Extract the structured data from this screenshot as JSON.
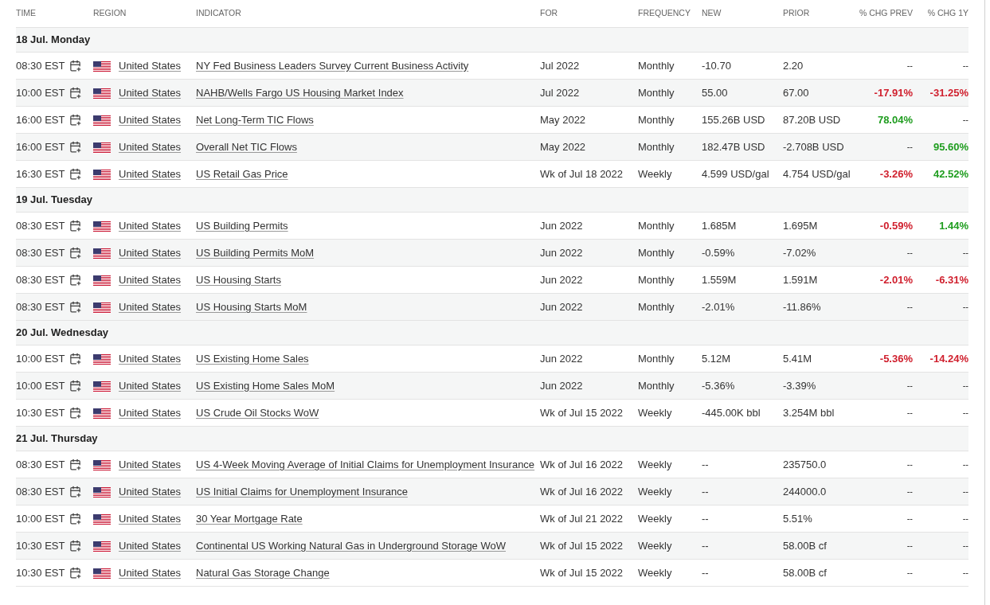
{
  "columns": [
    "TIME",
    "REGION",
    "INDICATOR",
    "FOR",
    "FREQUENCY",
    "NEW",
    "PRIOR",
    "% CHG PREV",
    "% CHG 1Y"
  ],
  "groups": [
    {
      "date": "18 Jul. Monday",
      "rows": [
        {
          "time": "08:30 EST",
          "region": "United States",
          "indicator": "NY Fed Business Leaders Survey Current Business Activity",
          "for": "Jul 2022",
          "frequency": "Monthly",
          "new": "-10.70",
          "prior": "2.20",
          "chg_prev": {
            "text": "--",
            "kind": "none"
          },
          "chg_1y": {
            "text": "--",
            "kind": "none"
          }
        },
        {
          "time": "10:00 EST",
          "region": "United States",
          "indicator": "NAHB/Wells Fargo US Housing Market Index",
          "for": "Jul 2022",
          "frequency": "Monthly",
          "new": "55.00",
          "prior": "67.00",
          "chg_prev": {
            "text": "-17.91%",
            "kind": "down"
          },
          "chg_1y": {
            "text": "-31.25%",
            "kind": "down"
          }
        },
        {
          "time": "16:00 EST",
          "region": "United States",
          "indicator": "Net Long-Term TIC Flows",
          "for": "May 2022",
          "frequency": "Monthly",
          "new": "155.26B USD",
          "prior": "87.20B USD",
          "chg_prev": {
            "text": "78.04%",
            "kind": "up"
          },
          "chg_1y": {
            "text": "--",
            "kind": "none"
          }
        },
        {
          "time": "16:00 EST",
          "region": "United States",
          "indicator": "Overall Net TIC Flows",
          "for": "May 2022",
          "frequency": "Monthly",
          "new": "182.47B USD",
          "prior": "-2.708B USD",
          "chg_prev": {
            "text": "--",
            "kind": "none"
          },
          "chg_1y": {
            "text": "95.60%",
            "kind": "up"
          }
        },
        {
          "time": "16:30 EST",
          "region": "United States",
          "indicator": "US Retail Gas Price",
          "for": "Wk of Jul 18 2022",
          "frequency": "Weekly",
          "new": "4.599 USD/gal",
          "prior": "4.754 USD/gal",
          "chg_prev": {
            "text": "-3.26%",
            "kind": "down"
          },
          "chg_1y": {
            "text": "42.52%",
            "kind": "up"
          }
        }
      ]
    },
    {
      "date": "19 Jul. Tuesday",
      "rows": [
        {
          "time": "08:30 EST",
          "region": "United States",
          "indicator": "US Building Permits",
          "for": "Jun 2022",
          "frequency": "Monthly",
          "new": "1.685M",
          "prior": "1.695M",
          "chg_prev": {
            "text": "-0.59%",
            "kind": "down"
          },
          "chg_1y": {
            "text": "1.44%",
            "kind": "up"
          }
        },
        {
          "time": "08:30 EST",
          "region": "United States",
          "indicator": "US Building Permits MoM",
          "for": "Jun 2022",
          "frequency": "Monthly",
          "new": "-0.59%",
          "prior": "-7.02%",
          "chg_prev": {
            "text": "--",
            "kind": "none"
          },
          "chg_1y": {
            "text": "--",
            "kind": "none"
          }
        },
        {
          "time": "08:30 EST",
          "region": "United States",
          "indicator": "US Housing Starts",
          "for": "Jun 2022",
          "frequency": "Monthly",
          "new": "1.559M",
          "prior": "1.591M",
          "chg_prev": {
            "text": "-2.01%",
            "kind": "down"
          },
          "chg_1y": {
            "text": "-6.31%",
            "kind": "down"
          }
        },
        {
          "time": "08:30 EST",
          "region": "United States",
          "indicator": "US Housing Starts MoM",
          "for": "Jun 2022",
          "frequency": "Monthly",
          "new": "-2.01%",
          "prior": "-11.86%",
          "chg_prev": {
            "text": "--",
            "kind": "none"
          },
          "chg_1y": {
            "text": "--",
            "kind": "none"
          }
        }
      ]
    },
    {
      "date": "20 Jul. Wednesday",
      "rows": [
        {
          "time": "10:00 EST",
          "region": "United States",
          "indicator": "US Existing Home Sales",
          "for": "Jun 2022",
          "frequency": "Monthly",
          "new": "5.12M",
          "prior": "5.41M",
          "chg_prev": {
            "text": "-5.36%",
            "kind": "down"
          },
          "chg_1y": {
            "text": "-14.24%",
            "kind": "down"
          }
        },
        {
          "time": "10:00 EST",
          "region": "United States",
          "indicator": "US Existing Home Sales MoM",
          "for": "Jun 2022",
          "frequency": "Monthly",
          "new": "-5.36%",
          "prior": "-3.39%",
          "chg_prev": {
            "text": "--",
            "kind": "none"
          },
          "chg_1y": {
            "text": "--",
            "kind": "none"
          }
        },
        {
          "time": "10:30 EST",
          "region": "United States",
          "indicator": "US Crude Oil Stocks WoW",
          "for": "Wk of Jul 15 2022",
          "frequency": "Weekly",
          "new": "-445.00K bbl",
          "prior": "3.254M bbl",
          "chg_prev": {
            "text": "--",
            "kind": "none"
          },
          "chg_1y": {
            "text": "--",
            "kind": "none"
          }
        }
      ]
    },
    {
      "date": "21 Jul. Thursday",
      "rows": [
        {
          "time": "08:30 EST",
          "region": "United States",
          "indicator": "US 4-Week Moving Average of Initial Claims for Unemployment Insurance",
          "for": "Wk of Jul 16 2022",
          "frequency": "Weekly",
          "new": "--",
          "prior": "235750.0",
          "chg_prev": {
            "text": "--",
            "kind": "none"
          },
          "chg_1y": {
            "text": "--",
            "kind": "none"
          }
        },
        {
          "time": "08:30 EST",
          "region": "United States",
          "indicator": "US Initial Claims for Unemployment Insurance",
          "for": "Wk of Jul 16 2022",
          "frequency": "Weekly",
          "new": "--",
          "prior": "244000.0",
          "chg_prev": {
            "text": "--",
            "kind": "none"
          },
          "chg_1y": {
            "text": "--",
            "kind": "none"
          }
        },
        {
          "time": "10:00 EST",
          "region": "United States",
          "indicator": "30 Year Mortgage Rate",
          "for": "Wk of Jul 21 2022",
          "frequency": "Weekly",
          "new": "--",
          "prior": "5.51%",
          "chg_prev": {
            "text": "--",
            "kind": "none"
          },
          "chg_1y": {
            "text": "--",
            "kind": "none"
          }
        },
        {
          "time": "10:30 EST",
          "region": "United States",
          "indicator": "Continental US Working Natural Gas in Underground Storage WoW",
          "for": "Wk of Jul 15 2022",
          "frequency": "Weekly",
          "new": "--",
          "prior": "58.00B cf",
          "chg_prev": {
            "text": "--",
            "kind": "none"
          },
          "chg_1y": {
            "text": "--",
            "kind": "none"
          }
        },
        {
          "time": "10:30 EST",
          "region": "United States",
          "indicator": "Natural Gas Storage Change",
          "for": "Wk of Jul 15 2022",
          "frequency": "Weekly",
          "new": "--",
          "prior": "58.00B cf",
          "chg_prev": {
            "text": "--",
            "kind": "none"
          },
          "chg_1y": {
            "text": "--",
            "kind": "none"
          }
        }
      ]
    }
  ]
}
